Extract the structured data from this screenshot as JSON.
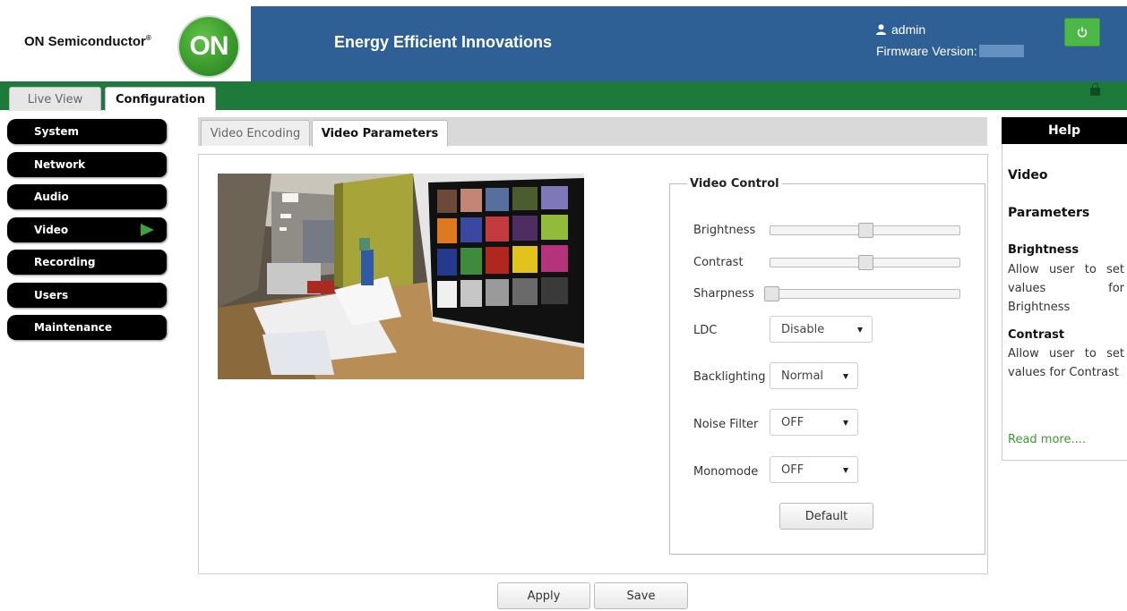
{
  "header": {
    "brand": "ON Semiconductor",
    "brand_mark": "®",
    "logo_text": "ON",
    "tagline": "Energy Efficient Innovations",
    "user": "admin",
    "firmware_label": "Firmware Version:",
    "header_color": "#2e5f95",
    "power_color": "#4cb848"
  },
  "nav": {
    "tabs": [
      {
        "label": "Live View",
        "active": false
      },
      {
        "label": "Configuration",
        "active": true
      }
    ],
    "bar_color": "#1d7a3a"
  },
  "sidebar": {
    "items": [
      {
        "label": "System"
      },
      {
        "label": "Network"
      },
      {
        "label": "Audio"
      },
      {
        "label": "Video",
        "active": true
      },
      {
        "label": "Recording"
      },
      {
        "label": "Users"
      },
      {
        "label": "Maintenance"
      }
    ]
  },
  "subtabs": [
    {
      "label": "Video Encoding",
      "active": false
    },
    {
      "label": "Video Parameters",
      "active": true
    }
  ],
  "video_control": {
    "legend": "Video Control",
    "brightness": {
      "label": "Brightness",
      "level": 0.5
    },
    "contrast": {
      "label": "Contrast",
      "level": 0.5
    },
    "sharpness": {
      "label": "Sharpness",
      "level": 0.0
    },
    "ldc": {
      "label": "LDC",
      "value": "Disable"
    },
    "backlighting": {
      "label": "Backlighting",
      "value": "Normal"
    },
    "noise_filter": {
      "label": "Noise Filter",
      "value": "OFF"
    },
    "monomode": {
      "label": "Monomode",
      "value": "OFF"
    },
    "default_label": "Default"
  },
  "actions": {
    "apply": "Apply",
    "save": "Save"
  },
  "help": {
    "title": "Help",
    "heading1": "Video",
    "heading2": "Parameters",
    "brightness_title": "Brightness",
    "brightness_text": "Allow user to set values for Brightness",
    "contrast_title": "Contrast",
    "contrast_text": "Allow user to set values for Contrast",
    "read_more": "Read more...."
  }
}
